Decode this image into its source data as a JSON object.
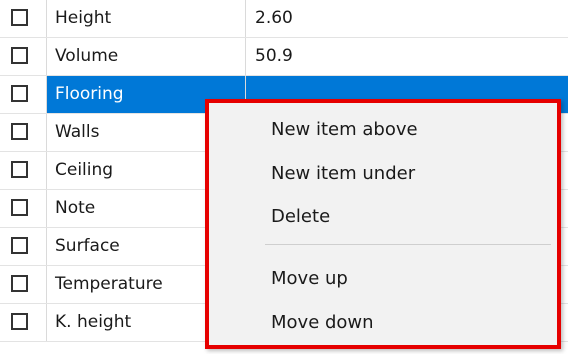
{
  "rows": [
    {
      "label": "Height",
      "value": "2.60",
      "checked": false
    },
    {
      "label": "Volume",
      "value": "50.9",
      "checked": false
    },
    {
      "label": "Flooring",
      "value": "",
      "checked": false,
      "selected": true
    },
    {
      "label": "Walls",
      "value": "",
      "checked": false
    },
    {
      "label": "Ceiling",
      "value": "",
      "checked": false
    },
    {
      "label": "Note",
      "value": "",
      "checked": false
    },
    {
      "label": "Surface",
      "value": "",
      "checked": false
    },
    {
      "label": "Temperature",
      "value": "",
      "checked": false
    },
    {
      "label": "K. height",
      "value": "",
      "checked": false
    }
  ],
  "context_menu": {
    "items": [
      {
        "label": "New item above"
      },
      {
        "label": "New item under"
      },
      {
        "label": "Delete"
      },
      {
        "label": "Move up"
      },
      {
        "label": "Move down"
      }
    ]
  },
  "colors": {
    "selection": "#0078d7",
    "highlight_border": "#e60000"
  }
}
